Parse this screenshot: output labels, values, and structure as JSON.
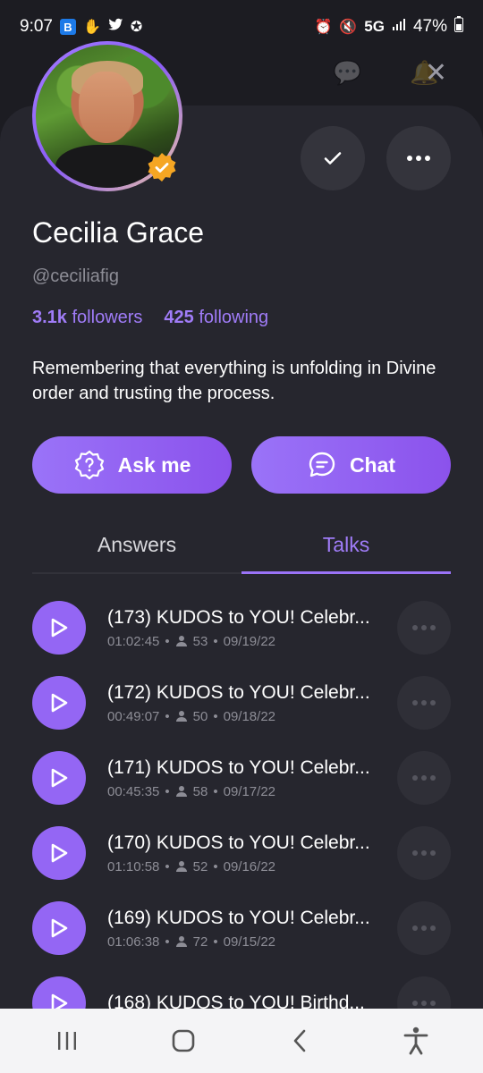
{
  "status_bar": {
    "time": "9:07",
    "left_badge": "B",
    "network": "5G",
    "battery": "47%"
  },
  "profile": {
    "name": "Cecilia Grace",
    "handle": "@ceciliafig",
    "followers_count": "3.1k",
    "followers_label": "followers",
    "following_count": "425",
    "following_label": "following",
    "bio": "Remembering that everything is unfolding in Divine order and trusting the process."
  },
  "actions": {
    "ask_label": "Ask me",
    "chat_label": "Chat"
  },
  "tabs": [
    {
      "label": "Answers",
      "active": false
    },
    {
      "label": "Talks",
      "active": true
    }
  ],
  "talks": [
    {
      "title": "(173) KUDOS to YOU! Celebr...",
      "duration": "01:02:45",
      "listeners": "53",
      "date": "09/19/22"
    },
    {
      "title": "(172) KUDOS to YOU! Celebr...",
      "duration": "00:49:07",
      "listeners": "50",
      "date": "09/18/22"
    },
    {
      "title": "(171) KUDOS to YOU! Celebr...",
      "duration": "00:45:35",
      "listeners": "58",
      "date": "09/17/22"
    },
    {
      "title": "(170) KUDOS to YOU! Celebr...",
      "duration": "01:10:58",
      "listeners": "52",
      "date": "09/16/22"
    },
    {
      "title": "(169) KUDOS to YOU! Celebr...",
      "duration": "01:06:38",
      "listeners": "72",
      "date": "09/15/22"
    },
    {
      "title": "(168) KUDOS to YOU! Birthd...",
      "duration": "",
      "listeners": "",
      "date": ""
    }
  ],
  "colors": {
    "accent": "#9a73f8",
    "background": "#1c1c22",
    "sheet": "#26262e"
  }
}
